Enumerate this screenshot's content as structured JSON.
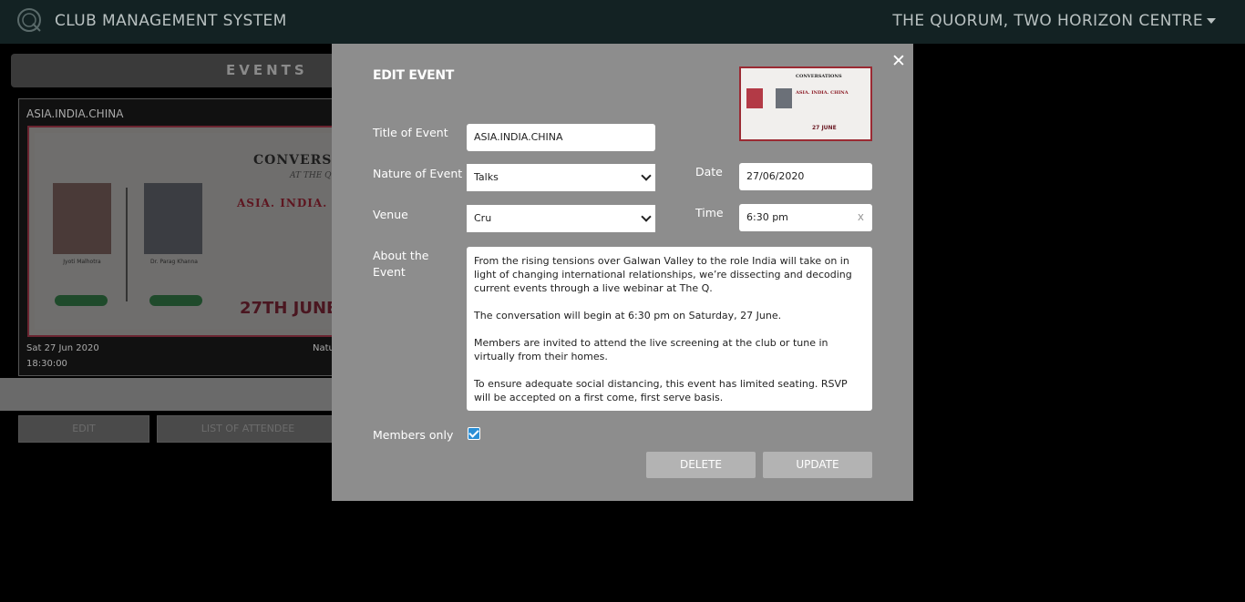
{
  "header": {
    "app_title": "CLUB MANAGEMENT SYSTEM",
    "club_name": "THE QUORUM, TWO HORIZON CENTRE"
  },
  "events_page": {
    "section_title": "EVENTS",
    "card": {
      "title": "ASIA.INDIA.CHINA",
      "date": "Sat 27 Jun 2020",
      "time": "18:30:00",
      "nature_label": "Natu",
      "poster": {
        "conversations": "CONVERSATIO",
        "at_the_q": "AT THE Q",
        "headline": "ASIA. INDIA. C",
        "speaker1": "Jyoti Malhotra",
        "speaker2": "Dr. Parag Khanna",
        "date_text": "27TH JUNE"
      }
    },
    "edit_button": "EDIT",
    "attendees_button": "LIST OF ATTENDEE"
  },
  "modal": {
    "title": "EDIT EVENT",
    "close_icon": "close-icon",
    "thumbnail": {
      "line1": "CONVERSATIONS",
      "line2": "ASIA. INDIA. CHINA",
      "date": "27 JUNE"
    },
    "fields": {
      "title_label": "Title of Event",
      "title_value": "ASIA.INDIA.CHINA",
      "nature_label": "Nature of Event",
      "nature_value": "Talks",
      "venue_label": "Venue",
      "venue_value": "Cru",
      "date_label": "Date",
      "date_value": "27/06/2020",
      "time_label": "Time",
      "time_value": "6:30 pm",
      "time_clear": "x",
      "about_label": "About the Event",
      "about_paragraphs": [
        "From the rising tensions over Galwan Valley to the role India will take on in light of changing international relationships, we’re dissecting and decoding current events through a live webinar at The Q.",
        "The conversation will begin at 6:30 pm on Saturday, 27 June.",
        "Members are invited to attend the live screening at the club or tune in virtually from their homes.",
        "To ensure adequate social distancing, this event has limited seating. RSVP will be accepted on a first come, first serve basis."
      ],
      "members_only_label": "Members only",
      "members_only_checked": true
    },
    "delete_button": "DELETE",
    "update_button": "UPDATE"
  }
}
